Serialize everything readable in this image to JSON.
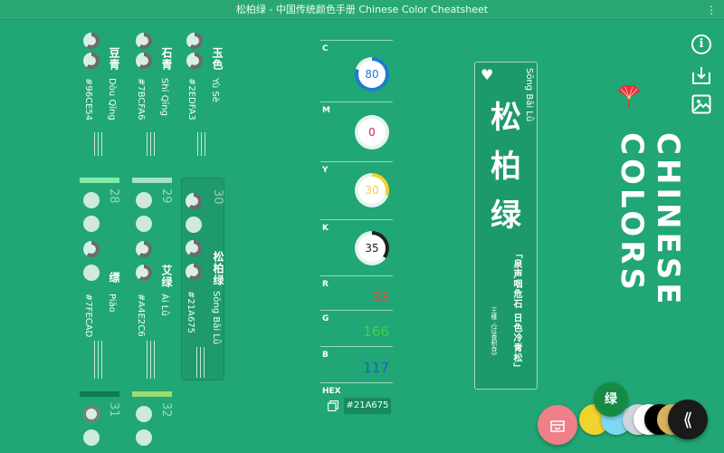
{
  "window": {
    "title": "松柏绿 - 中国传统颜色手册 Chinese Color Cheatsheet"
  },
  "colors": [
    {
      "name": "豆青",
      "pinyin": "Dòu Qīng",
      "hex": "#96CE54"
    },
    {
      "name": "石青",
      "pinyin": "Shí Qīng",
      "hex": "#7BCFA6"
    },
    {
      "name": "玉色",
      "pinyin": "Yù Sè",
      "hex": "#2EDFA3"
    },
    {
      "number": "28",
      "bar": "#7FECAD"
    },
    {
      "number": "29",
      "bar": "#A4E2C6"
    },
    {
      "number": "30",
      "name": "松柏绿",
      "pinyin": "Sōng Bǎi Lǜ",
      "hex": "#21A675"
    },
    {
      "name": "缥",
      "pinyin": "Piāo",
      "hex": "#7FECAD"
    },
    {
      "name": "艾绿",
      "pinyin": "Ài Lǜ",
      "hex": "#A4E2C6"
    },
    {
      "number": "31",
      "bar": "#0E7B54"
    },
    {
      "number": "32",
      "bar": "#9DDD70"
    }
  ],
  "cmyk": {
    "c": {
      "label": "C",
      "value": "80",
      "color": "#1f7bd1"
    },
    "m": {
      "label": "M",
      "value": "0",
      "color": "#d0213c"
    },
    "y": {
      "label": "Y",
      "value": "30",
      "color": "#f2d22c"
    },
    "k": {
      "label": "K",
      "value": "35",
      "color": "#222222"
    }
  },
  "rgb": {
    "r": {
      "label": "R",
      "value": "33",
      "color": "#e04a3c"
    },
    "g": {
      "label": "G",
      "value": "166",
      "color": "#3fd04f"
    },
    "b": {
      "label": "B",
      "value": "117",
      "color": "#1f5fd1"
    }
  },
  "hex": {
    "label": "HEX",
    "value": "#21A675"
  },
  "poem": {
    "pinyin": "Sōng Bǎi Lǜ",
    "title_chars": [
      "松",
      "柏",
      "绿"
    ],
    "verse": "「泉声咽危石 日色冷青松」",
    "author": "王维 ·《过香积寺》"
  },
  "brand": "CHINESE COLORS",
  "fab": {
    "label": "绿"
  },
  "collapse_label": "⟪",
  "swatches": [
    "#f2d22c",
    "#7fd7f2",
    "#cdd6da",
    "#ffffff",
    "#000000",
    "#d9b25c"
  ]
}
